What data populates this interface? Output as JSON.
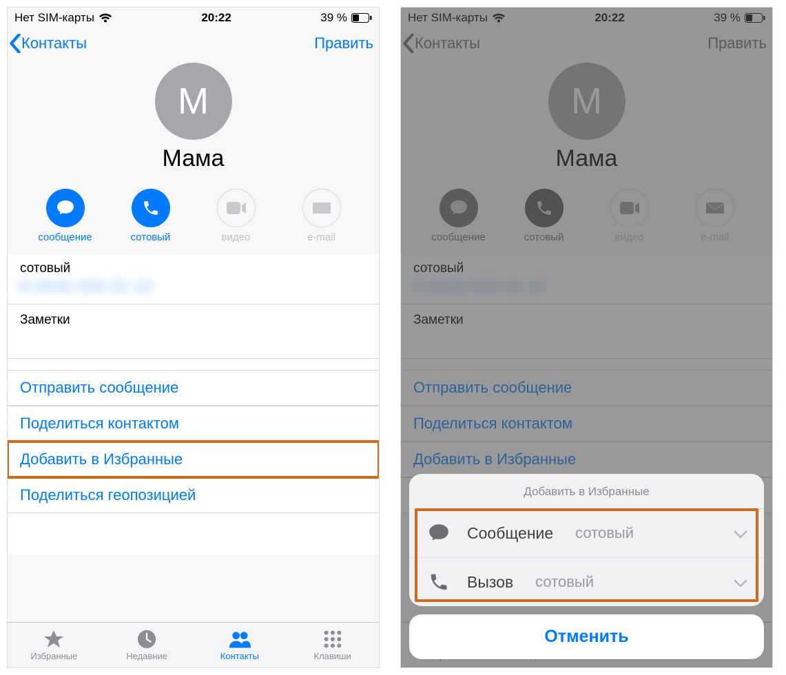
{
  "status": {
    "carrier": "Нет SIM-карты",
    "time": "20:22",
    "battery": "39 %"
  },
  "nav": {
    "back": "Контакты",
    "edit": "Править"
  },
  "contact": {
    "initial": "М",
    "name": "Мама"
  },
  "actions": {
    "message": "сообщение",
    "mobile": "сотовый",
    "video": "видео",
    "email": "e-mail"
  },
  "phone_section": {
    "label": "сотовый",
    "number_masked": "8 (916) 016-21-12"
  },
  "notes_label": "Заметки",
  "links": {
    "send_message": "Отправить сообщение",
    "share_contact": "Поделиться контактом",
    "add_favorite": "Добавить в Избранные",
    "share_location": "Поделиться геопозицией"
  },
  "tabs": {
    "favorites": "Избранные",
    "recents": "Недавние",
    "contacts": "Контакты",
    "keypad": "Клавиши"
  },
  "sheet": {
    "title": "Добавить в Избранные",
    "message": "Сообщение",
    "message_sub": "сотовый",
    "call": "Вызов",
    "call_sub": "сотовый",
    "cancel": "Отменить"
  }
}
